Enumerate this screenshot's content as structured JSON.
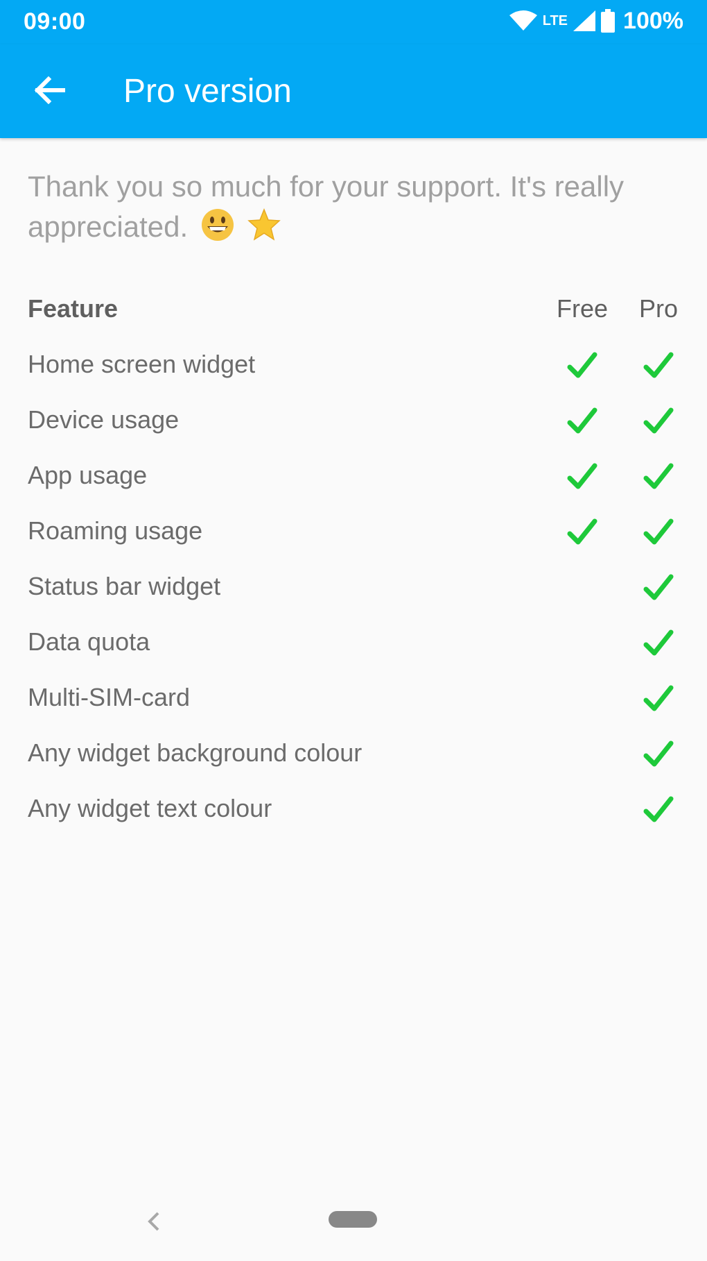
{
  "status_bar": {
    "time": "09:00",
    "network": "LTE",
    "battery": "100%"
  },
  "toolbar": {
    "title": "Pro version",
    "back_icon": "arrow-back-icon"
  },
  "intro": {
    "text": "Thank you so much for your support. It's really appreciated.",
    "emojis": [
      "grinning-face-icon",
      "star-icon"
    ]
  },
  "table": {
    "headers": {
      "feature": "Feature",
      "free": "Free",
      "pro": "Pro"
    },
    "rows": [
      {
        "feature": "Home screen widget",
        "free": true,
        "pro": true
      },
      {
        "feature": "Device usage",
        "free": true,
        "pro": true
      },
      {
        "feature": "App usage",
        "free": true,
        "pro": true
      },
      {
        "feature": "Roaming usage",
        "free": true,
        "pro": true
      },
      {
        "feature": "Status bar widget",
        "free": false,
        "pro": true
      },
      {
        "feature": "Data quota",
        "free": false,
        "pro": true
      },
      {
        "feature": "Multi-SIM-card",
        "free": false,
        "pro": true
      },
      {
        "feature": "Any widget background colour",
        "free": false,
        "pro": true
      },
      {
        "feature": "Any widget text colour",
        "free": false,
        "pro": true
      }
    ]
  },
  "colors": {
    "primary": "#03a9f4",
    "check": "#1ec93a",
    "background": "#fafafa"
  }
}
